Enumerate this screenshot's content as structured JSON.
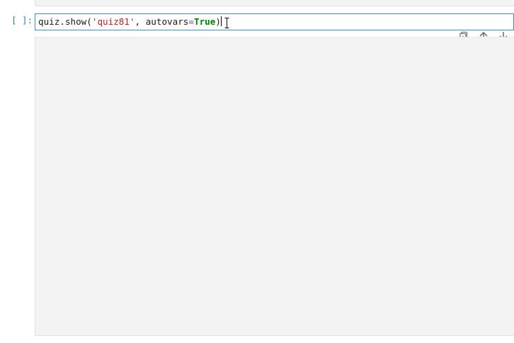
{
  "cell": {
    "prompt": "[ ]:",
    "code": {
      "obj": "quiz",
      "dot": ".",
      "method": "show",
      "open": "(",
      "arg_str": "'quiz81'",
      "comma": ", ",
      "kwarg": "autovars",
      "eq": "=",
      "value": "True",
      "close": ")"
    }
  },
  "toolbar": {
    "copy_icon": "duplicate-icon",
    "up_icon": "arrow-up-icon",
    "down_icon": "arrow-down-icon"
  },
  "colors": {
    "accent": "#3e8ecf",
    "prompt": "#2f6fa8",
    "string": "#ba2121",
    "keyword": "#008000",
    "output_bg": "#f3f3f3"
  }
}
